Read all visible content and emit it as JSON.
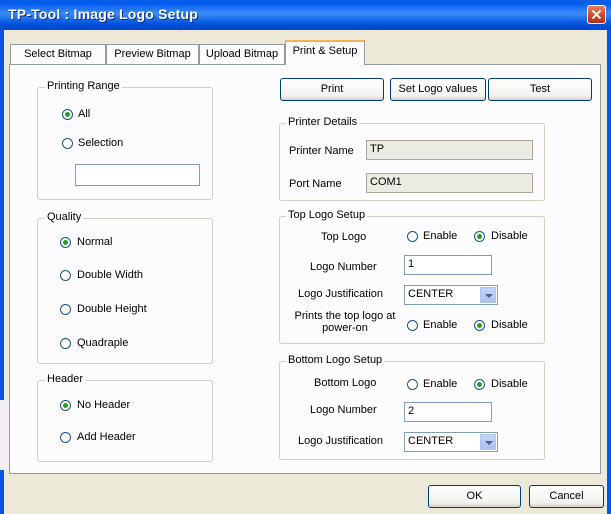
{
  "window": {
    "title": "TP-Tool : Image Logo Setup",
    "close_icon": "close-icon"
  },
  "tabs": [
    {
      "label": "Select Bitmap",
      "active": false
    },
    {
      "label": "Preview Bitmap",
      "active": false
    },
    {
      "label": "Upload Bitmap",
      "active": false
    },
    {
      "label": "Print & Setup",
      "active": true
    }
  ],
  "printing_range": {
    "legend": "Printing Range",
    "options": [
      "All",
      "Selection"
    ],
    "selected": "All",
    "selection_value": ""
  },
  "quality": {
    "legend": "Quality",
    "options": [
      "Normal",
      "Double Width",
      "Double Height",
      "Quadraple"
    ],
    "selected": "Normal"
  },
  "header": {
    "legend": "Header",
    "options": [
      "No Header",
      "Add Header"
    ],
    "selected": "No Header"
  },
  "buttons": {
    "print": "Print",
    "set_logo_values": "Set Logo values",
    "test": "Test",
    "ok": "OK",
    "cancel": "Cancel"
  },
  "printer_details": {
    "legend": "Printer Details",
    "printer_name_label": "Printer Name",
    "printer_name_value": "TP",
    "port_name_label": "Port Name",
    "port_name_value": "COM1"
  },
  "top_logo": {
    "legend": "Top Logo Setup",
    "top_logo_label": "Top Logo",
    "enable_label": "Enable",
    "disable_label": "Disable",
    "top_logo_selected": "Disable",
    "logo_number_label": "Logo Number",
    "logo_number_value": "1",
    "justification_label": "Logo Justification",
    "justification_value": "CENTER",
    "poweron_label_line1": "Prints the top logo at",
    "poweron_label_line2": "power-on",
    "poweron_selected": "Disable"
  },
  "bottom_logo": {
    "legend": "Bottom Logo Setup",
    "bottom_logo_label": "Bottom Logo",
    "enable_label": "Enable",
    "disable_label": "Disable",
    "bottom_logo_selected": "Disable",
    "logo_number_label": "Logo Number",
    "logo_number_value": "2",
    "justification_label": "Logo Justification",
    "justification_value": "CENTER"
  }
}
